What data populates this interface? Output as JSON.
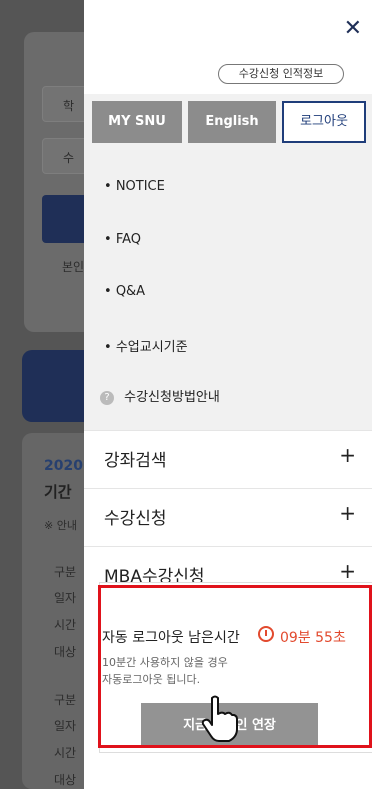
{
  "background": {
    "placeholders": [
      "학",
      "수"
    ],
    "link_text": "본인",
    "year_text": "2020",
    "period_text": "기간",
    "notice_text": "※ 안내",
    "rows": [
      "구분",
      "일자",
      "시간",
      "대상",
      "구분",
      "일자",
      "시간",
      "대상"
    ]
  },
  "drawer": {
    "close_icon": "close-icon",
    "personal_info_pill": "수강신청 인적정보",
    "buttons": {
      "my_snu": "MY SNU",
      "english": "English",
      "logout": "로그아웃"
    },
    "menu": [
      {
        "label": "NOTICE",
        "bullet": "•"
      },
      {
        "label": "FAQ",
        "bullet": "•"
      },
      {
        "label": "Q&A",
        "bullet": "•"
      },
      {
        "label": "수업교시기준",
        "bullet": "•"
      }
    ],
    "help": {
      "label": "수강신청방법안내",
      "icon": "?"
    },
    "accordions": [
      {
        "label": "강좌검색",
        "icon": "+"
      },
      {
        "label": "수강신청",
        "icon": "+"
      },
      {
        "label": "MBA수강신청",
        "icon": "+"
      }
    ]
  },
  "auto_logout": {
    "title": "자동 로그아웃 남은시간",
    "remaining": "09분 55초",
    "note_line1": "10분간 사용하지 않을 경우",
    "note_line2": "자동로그아웃 됩니다.",
    "extend_button": "지금 로그인 연장",
    "accent": "#e24a2e"
  }
}
